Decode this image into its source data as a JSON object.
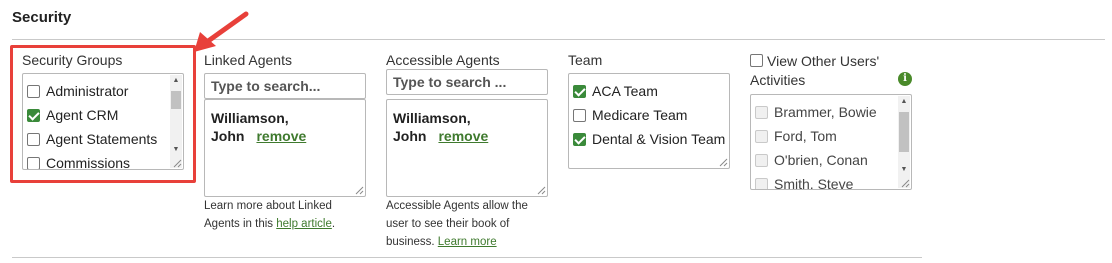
{
  "section": {
    "title": "Security"
  },
  "security_groups": {
    "label": "Security Groups",
    "items": [
      {
        "label": "Administrator",
        "checked": false
      },
      {
        "label": "Agent CRM",
        "checked": true
      },
      {
        "label": "Agent Statements",
        "checked": false
      },
      {
        "label": "Commissions",
        "checked": false
      }
    ]
  },
  "linked_agents": {
    "label": "Linked Agents",
    "search_placeholder": "Type to search...",
    "agent_first": "Williamson,",
    "agent_last": "John",
    "remove_label": "remove",
    "help_prefix": "Learn more about Linked Agents in this ",
    "help_link": "help article",
    "help_suffix": "."
  },
  "accessible_agents": {
    "label": "Accessible Agents",
    "search_placeholder": "Type to search ...",
    "agent_first": "Williamson,",
    "agent_last": "John",
    "remove_label": "remove",
    "help_text": "Accessible Agents allow the user to see their book of business. ",
    "help_link": "Learn more"
  },
  "team": {
    "label": "Team",
    "items": [
      {
        "label": "ACA Team",
        "checked": true
      },
      {
        "label": "Medicare Team",
        "checked": false
      },
      {
        "label": "Dental & Vision Team",
        "checked": true
      }
    ]
  },
  "view_other_users": {
    "label": "View Other Users' Activities",
    "checked": false,
    "info_icon": "info-icon",
    "items": [
      {
        "label": "Brammer, Bowie",
        "checked": false
      },
      {
        "label": "Ford, Tom",
        "checked": false
      },
      {
        "label": "O'brien, Conan",
        "checked": false
      },
      {
        "label": "Smith, Steve",
        "checked": false
      }
    ]
  },
  "colors": {
    "highlight": "#e8403a",
    "accent_green": "#3a8a3a",
    "link_green": "#3f7a2e"
  }
}
